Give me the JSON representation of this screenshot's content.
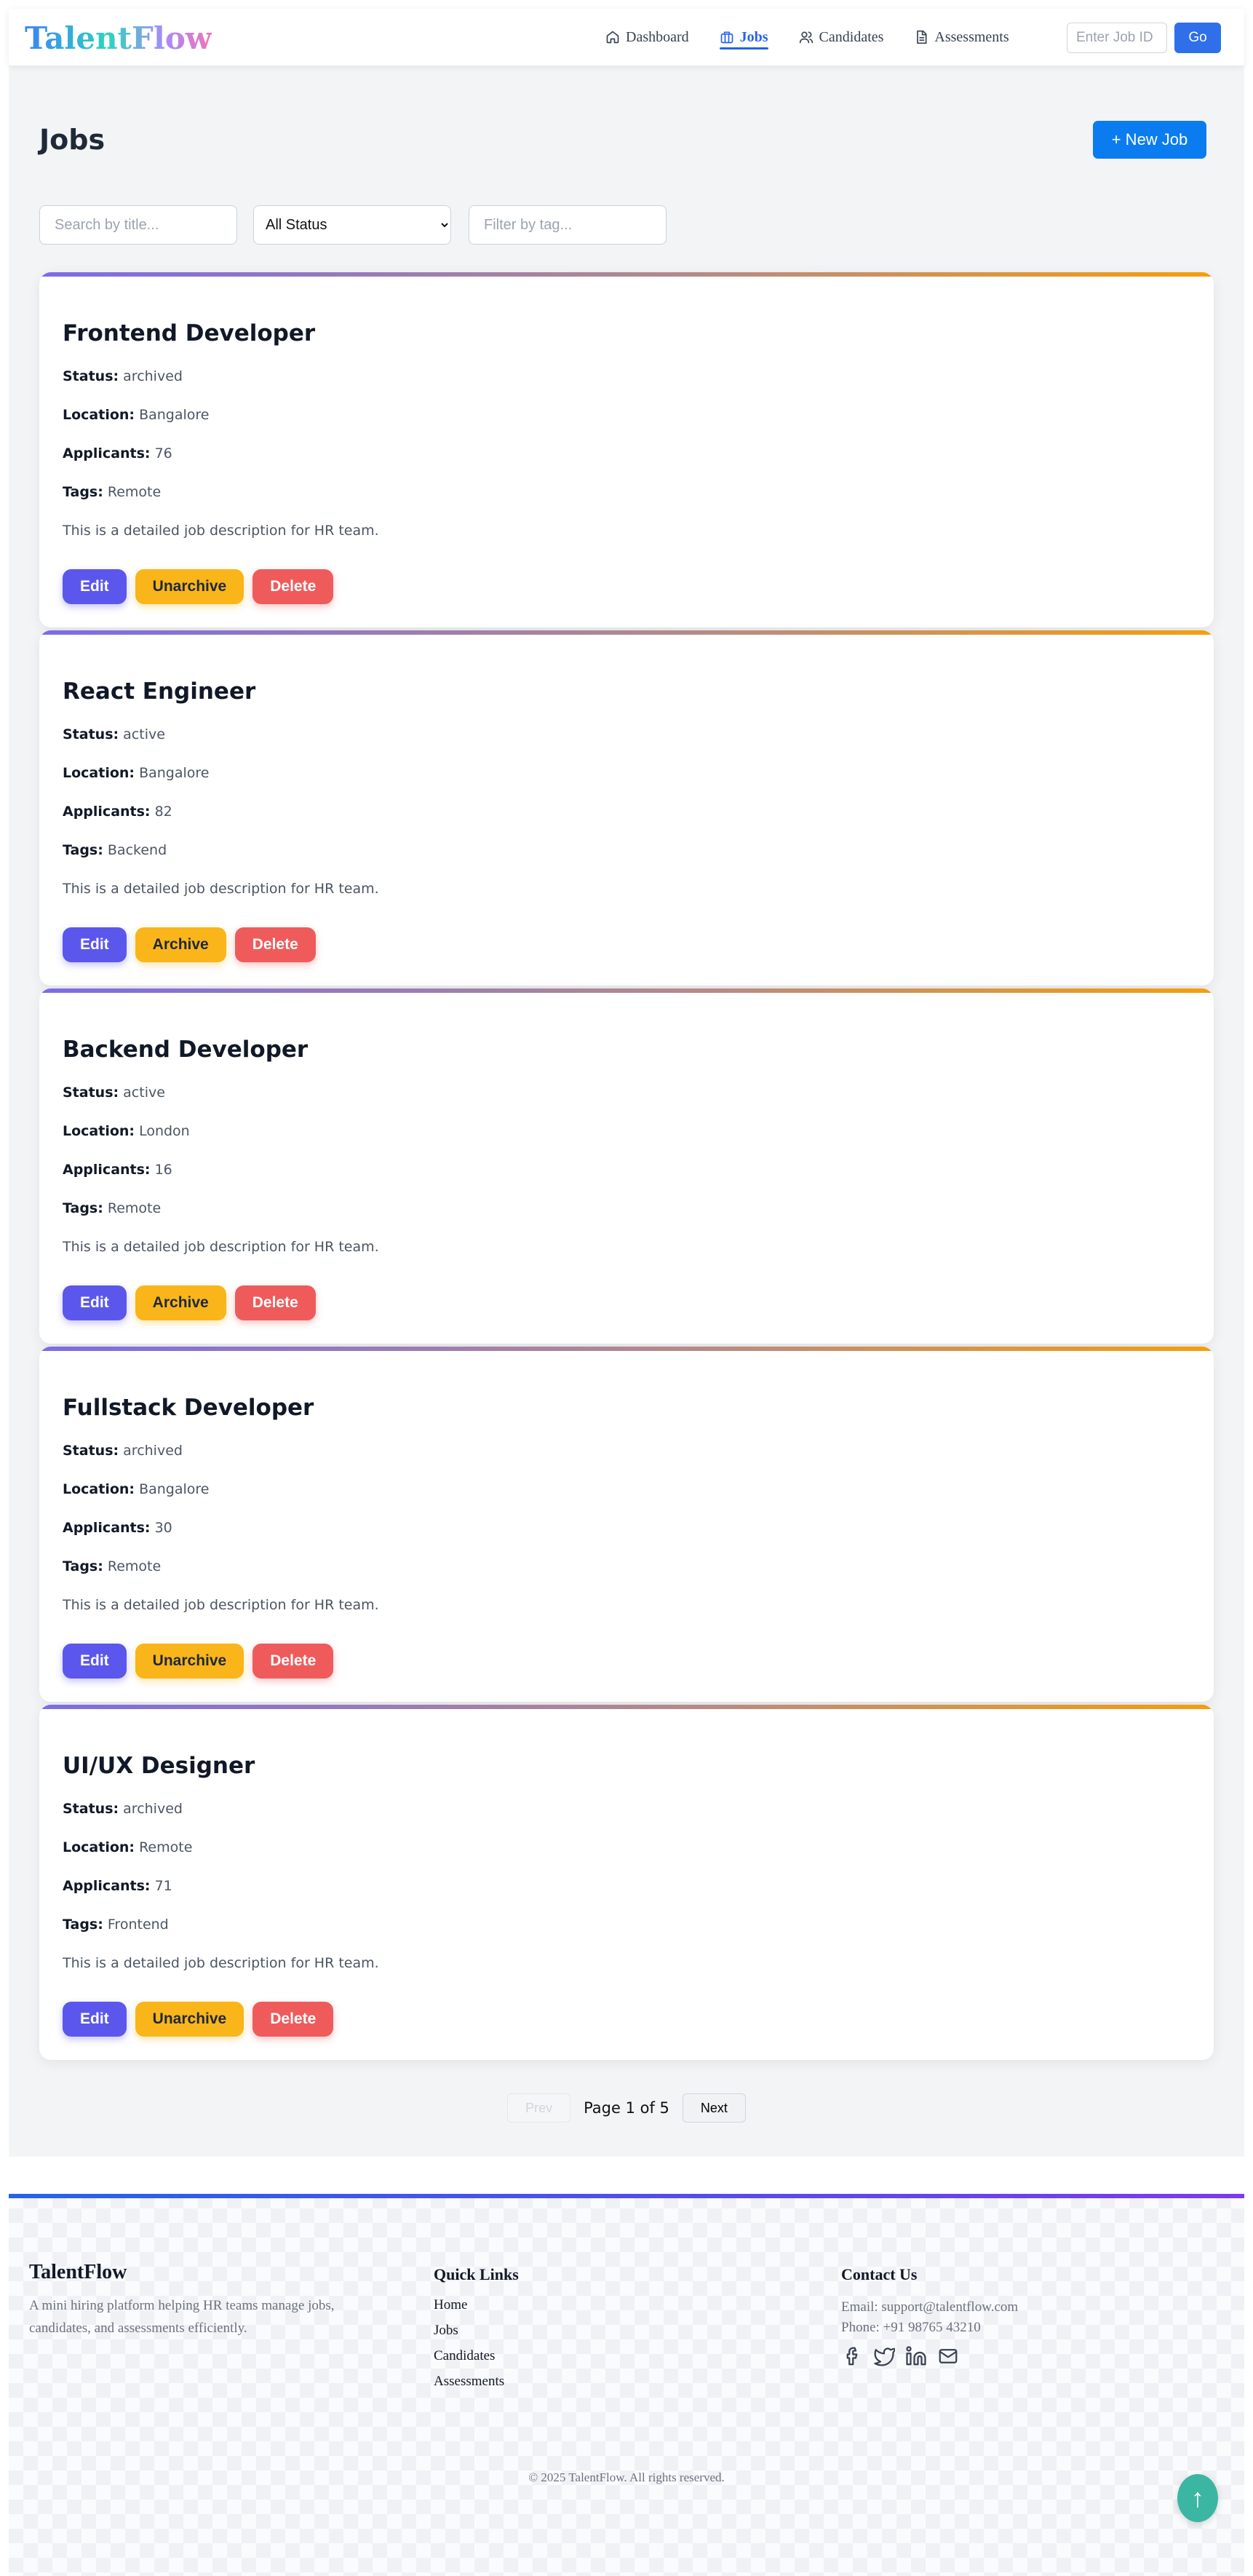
{
  "brand": "TalentFlow",
  "nav": {
    "links": [
      {
        "label": "Dashboard",
        "icon": "home-icon"
      },
      {
        "label": "Jobs",
        "icon": "briefcase-icon",
        "active": true
      },
      {
        "label": "Candidates",
        "icon": "users-icon"
      },
      {
        "label": "Assessments",
        "icon": "document-icon"
      }
    ],
    "job_id_placeholder": "Enter Job ID",
    "go_label": "Go"
  },
  "page": {
    "title": "Jobs",
    "new_job_label": "+ New Job"
  },
  "filters": {
    "search_placeholder": "Search by title...",
    "status_value": "All Status",
    "tag_placeholder": "Filter by tag..."
  },
  "labels": {
    "status": "Status:",
    "location": "Location:",
    "applicants": "Applicants:",
    "tags": "Tags:",
    "edit": "Edit",
    "delete": "Delete"
  },
  "jobs": [
    {
      "title": "Frontend Developer",
      "status": "archived",
      "location": "Bangalore",
      "applicants": "76",
      "tags": "Remote",
      "description": "This is a detailed job description for HR team.",
      "archive_label": "Unarchive"
    },
    {
      "title": "React Engineer",
      "status": "active",
      "location": "Bangalore",
      "applicants": "82",
      "tags": "Backend",
      "description": "This is a detailed job description for HR team.",
      "archive_label": "Archive"
    },
    {
      "title": "Backend Developer",
      "status": "active",
      "location": "London",
      "applicants": "16",
      "tags": "Remote",
      "description": "This is a detailed job description for HR team.",
      "archive_label": "Archive"
    },
    {
      "title": "Fullstack Developer",
      "status": "archived",
      "location": "Bangalore",
      "applicants": "30",
      "tags": "Remote",
      "description": "This is a detailed job description for HR team.",
      "archive_label": "Unarchive"
    },
    {
      "title": "UI/UX Designer",
      "status": "archived",
      "location": "Remote",
      "applicants": "71",
      "tags": "Frontend",
      "description": "This is a detailed job description for HR team.",
      "archive_label": "Unarchive"
    }
  ],
  "pagination": {
    "prev_label": "Prev",
    "page_text": "Page 1 of 5",
    "next_label": "Next"
  },
  "footer": {
    "brand": "TalentFlow",
    "description": "A mini hiring platform helping HR teams manage jobs, candidates, and assessments efficiently.",
    "quick_links_title": "Quick Links",
    "quick_links": [
      "Home",
      "Jobs",
      "Candidates",
      "Assessments"
    ],
    "contact_title": "Contact Us",
    "email": "Email: support@talentflow.com",
    "phone": "Phone: +91 98765 43210",
    "social_icons": [
      "facebook-icon",
      "twitter-icon",
      "linkedin-icon",
      "mail-icon"
    ],
    "copyright": "© 2025 TalentFlow. All rights reserved."
  },
  "scroll_top_glyph": "↑"
}
